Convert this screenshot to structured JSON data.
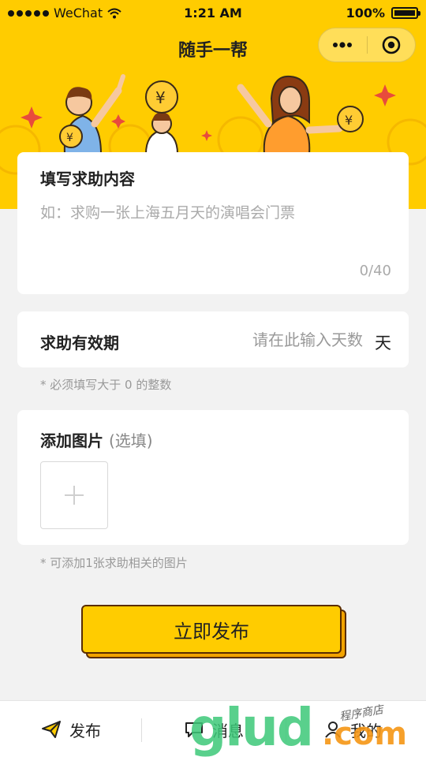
{
  "status_bar": {
    "carrier": "WeChat",
    "time": "1:21 AM",
    "battery": "100%"
  },
  "nav": {
    "title": "随手一帮",
    "more_icon": "more-dots-icon",
    "close_icon": "target-circle-icon"
  },
  "content_card": {
    "title": "填写求助内容",
    "placeholder": "如：求购一张上海五月天的演唱会门票",
    "char_count": "0/40"
  },
  "validity_card": {
    "title": "求助有效期",
    "placeholder": "请在此输入天数",
    "unit": "天",
    "hint": "* 必须填写大于 0 的整数"
  },
  "image_card": {
    "title": "添加图片",
    "optional": "(选填)",
    "hint": "* 可添加1张求助相关的图片"
  },
  "publish_button": {
    "label": "立即发布"
  },
  "tab_bar": {
    "items": [
      {
        "label": "发布",
        "icon": "paper-plane-icon"
      },
      {
        "label": "消息",
        "icon": "chat-bubble-icon"
      },
      {
        "label": "我的",
        "icon": "person-icon"
      }
    ]
  },
  "watermark": {
    "main": "glud",
    "dotcom": ".com",
    "small": "程序商店"
  },
  "colors": {
    "brand_yellow": "#ffcc00",
    "background": "#f2f2f2",
    "button_border": "#5a2d00"
  }
}
